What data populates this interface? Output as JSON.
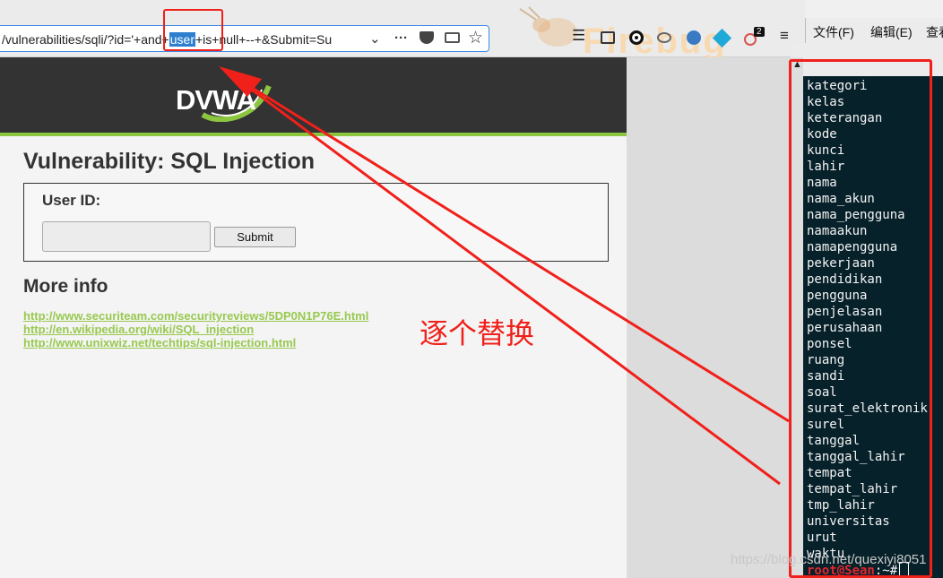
{
  "browser": {
    "url_before": "/vulnerabilities/sqli/?id='+and+",
    "url_highlight": "user",
    "url_after": "+is+null+--+&Submit=Su",
    "icons": [
      "chevron-down-icon",
      "more-icon",
      "pocket-icon",
      "reader-icon",
      "bookmark-star-icon",
      "library-icon",
      "sidebar-icon",
      "record-icon",
      "extension-icon",
      "extension-icon",
      "extension-icon",
      "extension-icon",
      "menu-icon"
    ],
    "extension_badge": "2",
    "watermark": "Firebug"
  },
  "page": {
    "logo": "DVWA",
    "title": "Vulnerability: SQL Injection",
    "user_id_label": "User ID:",
    "user_id_value": "",
    "submit_label": "Submit",
    "more_info_title": "More info",
    "links": [
      "http://www.securiteam.com/securityreviews/5DP0N1P76E.html",
      "http://en.wikipedia.org/wiki/SQL_injection",
      "http://www.unixwiz.net/techtips/sql-injection.html"
    ]
  },
  "terminal": {
    "menu": [
      "文件(F)",
      "编辑(E)",
      "查看"
    ],
    "lines": [
      "kategori",
      "kelas",
      "keterangan",
      "kode",
      "kunci",
      "lahir",
      "nama",
      "nama_akun",
      "nama_pengguna",
      "namaakun",
      "namapengguna",
      "pekerjaan",
      "pendidikan",
      "pengguna",
      "penjelasan",
      "perusahaan",
      "ponsel",
      "ruang",
      "sandi",
      "soal",
      "surat_elektronik",
      "surel",
      "tanggal",
      "tanggal_lahir",
      "tempat",
      "tempat_lahir",
      "tmp_lahir",
      "universitas",
      "urut",
      "waktu"
    ],
    "prompt_user": "root@Sean",
    "prompt_rest": ":~#"
  },
  "annotation": {
    "text": "逐个替换",
    "color": "#f0201a"
  },
  "watermark_text": "https://blog.csdn.net/quexiyi8051",
  "colors": {
    "dvwa_green": "#8cc63f",
    "link_green": "#98c94f",
    "terminal_bg": "#07212a",
    "url_highlight": "#2f7fcf"
  }
}
